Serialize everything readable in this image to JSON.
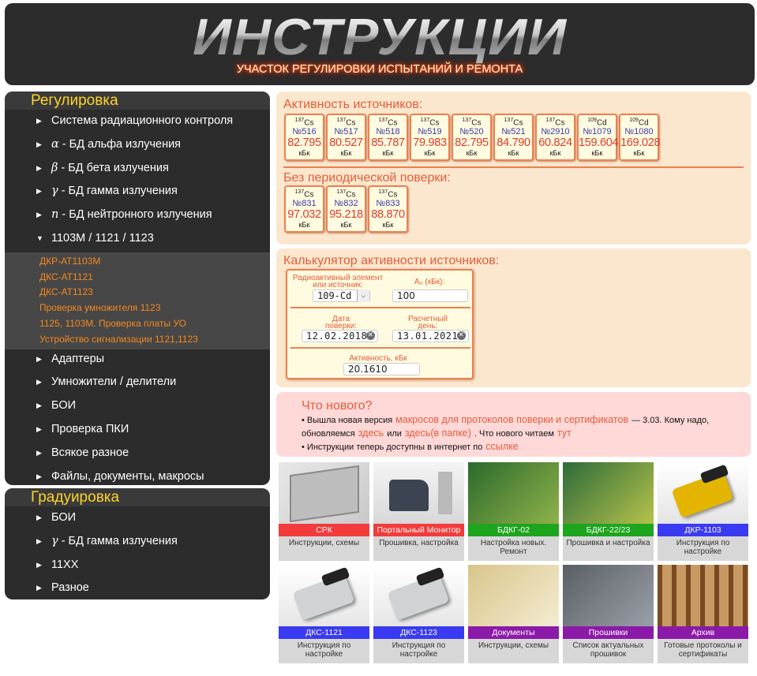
{
  "header": {
    "logo": "ИНСТРУКЦИИ",
    "subtitle": "УЧАСТОК РЕГУЛИРОВКИ ИСПЫТАНИЙ И РЕМОНТА"
  },
  "nav1": {
    "title": "Регулировка",
    "items": [
      {
        "pre": "",
        "greek": "",
        "label": "Система радиационного контроля"
      },
      {
        "pre": "",
        "greek": "α",
        "label": " - БД альфа излучения"
      },
      {
        "pre": "",
        "greek": "β",
        "label": " - БД бета излучения"
      },
      {
        "pre": "",
        "greek": "γ",
        "label": " - БД гамма излучения"
      },
      {
        "pre": "",
        "greek": "n",
        "label": " - БД нейтронного излучения"
      },
      {
        "pre": "",
        "greek": "",
        "label": "1103М / 1121 / 1123"
      }
    ],
    "subitems": [
      "ДКР-АТ1103М",
      "ДКС-АТ1121",
      "ДКС-АТ1123",
      "Проверка умножителя 1123",
      "1125, 1103М. Проверка платы УО",
      "Устройство сигнализации 1121,1123"
    ],
    "items2": [
      "Адаптеры",
      "Умножители / делители",
      "БОИ",
      "Проверка ПКИ",
      "Всякое разное",
      "Файлы, документы, макросы"
    ]
  },
  "nav2": {
    "title": "Градуировка",
    "items": [
      {
        "greek": "",
        "label": "БОИ"
      },
      {
        "greek": "γ",
        "label": " - БД гамма излучения"
      },
      {
        "greek": "",
        "label": "11ХХ"
      },
      {
        "greek": "",
        "label": "Разное"
      }
    ]
  },
  "activity": {
    "title": "Активность источников:",
    "sources": [
      {
        "iso": "137",
        "el": "Cs",
        "num": "№516",
        "val": "82.795",
        "unit": "кБк"
      },
      {
        "iso": "137",
        "el": "Cs",
        "num": "№517",
        "val": "80.527",
        "unit": "кБк"
      },
      {
        "iso": "137",
        "el": "Cs",
        "num": "№518",
        "val": "85.787",
        "unit": "кБк"
      },
      {
        "iso": "137",
        "el": "Cs",
        "num": "№519",
        "val": "79.983",
        "unit": "кБк"
      },
      {
        "iso": "137",
        "el": "Cs",
        "num": "№520",
        "val": "82.795",
        "unit": "кБк"
      },
      {
        "iso": "137",
        "el": "Cs",
        "num": "№521",
        "val": "84.790",
        "unit": "кБк"
      },
      {
        "iso": "137",
        "el": "Cs",
        "num": "№2910",
        "val": "60.824",
        "unit": "кБк"
      },
      {
        "iso": "109",
        "el": "Cd",
        "num": "№1079",
        "val": "159.604",
        "unit": "кБк"
      },
      {
        "iso": "109",
        "el": "Cd",
        "num": "№1080",
        "val": "169.028",
        "unit": "кБк"
      }
    ],
    "title2": "Без периодической поверки:",
    "sources2": [
      {
        "iso": "137",
        "el": "Cs",
        "num": "№831",
        "val": "97.032",
        "unit": "кБк"
      },
      {
        "iso": "137",
        "el": "Cs",
        "num": "№832",
        "val": "95.218",
        "unit": "кБк"
      },
      {
        "iso": "137",
        "el": "Cs",
        "num": "№833",
        "val": "88.870",
        "unit": "кБк"
      }
    ]
  },
  "calc": {
    "title": "Калькулятор активности источников:",
    "elem_label": "Радиоактивный элемент или источник:",
    "elem_value": "109-Cd",
    "a0_label": "A₀ (кБк):",
    "a0_value": "100",
    "date1_label": "Дата поверки:",
    "date1_value": "12.02.2018",
    "date2_label": "Расчетный день:",
    "date2_value": "13.01.2021",
    "result_label": "Активность, кБк",
    "result_value": "20.1610"
  },
  "news": {
    "title": "Что нового?",
    "l1_a": "• Вышла новая версия",
    "l1_link": "макросов для протоколов поверки и сертификатов",
    "l1_b": "— 3.03. Кому надо,",
    "l2_a": "обновляемся",
    "l2_link1": "здесь",
    "l2_b": "или",
    "l2_link2": "здесь(в папке)",
    "l2_c": ". Что нового читаем",
    "l2_link3": "тут",
    "l3_a": "• Инструкции теперь доступны в интернет по",
    "l3_link": "ссылке"
  },
  "cards": [
    {
      "label": "СРК",
      "desc": "Инструкции, схемы",
      "color": "#f23b3b"
    },
    {
      "label": "Портальный Монитор",
      "desc": "Прошивка, настройка",
      "color": "#f23b3b"
    },
    {
      "label": "БДКГ-02",
      "desc": "Настройка новых. Ремонт",
      "color": "#1ea51e"
    },
    {
      "label": "БДКГ-22/23",
      "desc": "Прошивка и настройка",
      "color": "#1ea51e"
    },
    {
      "label": "ДКР-1103",
      "desc": "Инструкция по настройке",
      "color": "#3a3af2"
    },
    {
      "label": "ДКС-1121",
      "desc": "Инструкция по настройке",
      "color": "#3a3af2"
    },
    {
      "label": "ДКС-1123",
      "desc": "Инструкция по настройке",
      "color": "#3a3af2"
    },
    {
      "label": "Документы",
      "desc": "Инструкции, схемы",
      "color": "#8c1aa8"
    },
    {
      "label": "Прошивки",
      "desc": "Список актуальных прошивок",
      "color": "#8c1aa8"
    },
    {
      "label": "Архив",
      "desc": "Готовые протоколы и сертификаты",
      "color": "#8c1aa8"
    }
  ]
}
